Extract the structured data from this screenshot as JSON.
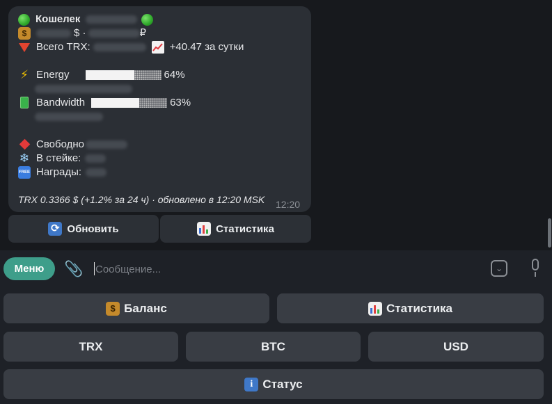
{
  "message": {
    "wallet_label": "Кошелек",
    "usd_sign": "$ ·",
    "rub_sign": "₽",
    "total_trx_label": "Всего TRX:",
    "daily_change": "+40.47 за сутки",
    "energy_label": "Energy",
    "energy_percent": "64%",
    "energy_fraction": 0.64,
    "bandwidth_label": "Bandwidth",
    "bandwidth_percent": "63%",
    "bandwidth_fraction": 0.63,
    "free_label": "Свободно",
    "staked_label": "В стейке:",
    "rewards_label": "Награды:",
    "footer": "TRX 0.3366 $ (+1.2% за 24 ч) · обновлено в 12:20 MSK",
    "time": "12:20"
  },
  "inline_buttons": {
    "refresh_label": "Обновить",
    "stats_label": "Статистика"
  },
  "input": {
    "menu_label": "Меню",
    "placeholder": "Сообщение..."
  },
  "keyboard": {
    "balance_label": "Баланс",
    "stats_label": "Статистика",
    "trx_label": "TRX",
    "btc_label": "BTC",
    "usd_label": "USD",
    "status_label": "Статус"
  },
  "colors": {
    "chat_bg": "#17191d",
    "bubble_bg": "#2b2f35",
    "menu_button": "#3e9e8a",
    "keyboard_button": "#393d44"
  },
  "icons": {
    "wallet": "green-circle-icon",
    "money": "money-bag-icon",
    "total": "red-triangle-icon",
    "change": "chart-increasing-icon",
    "energy": "lightning-icon",
    "bandwidth": "battery-icon",
    "free": "red-diamond-icon",
    "staked": "snowflake-icon",
    "rewards": "free-badge-icon",
    "refresh": "refresh-icon",
    "stats": "bar-chart-icon",
    "status": "info-icon"
  }
}
